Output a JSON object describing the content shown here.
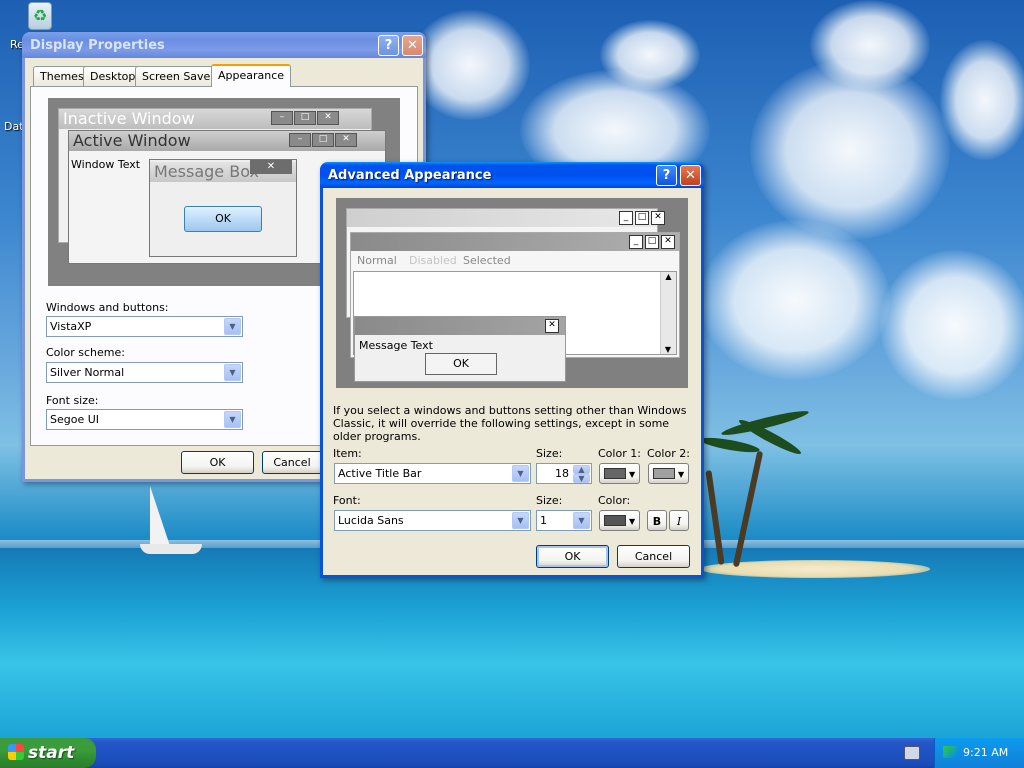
{
  "desktop": {
    "icons": [
      {
        "label": "Re",
        "icon": "recycle-bin-icon"
      },
      {
        "label": "Dat"
      }
    ]
  },
  "display_properties": {
    "title": "Display Properties",
    "tabs": [
      "Themes",
      "Desktop",
      "Screen Saver",
      "Appearance"
    ],
    "active_tab": "Appearance",
    "preview": {
      "inactive_window": "Inactive Window",
      "active_window": "Active Window",
      "window_text": "Window Text",
      "message_box": "Message Box",
      "ok": "OK"
    },
    "windows_and_buttons": {
      "label": "Windows and buttons:",
      "value": "VistaXP"
    },
    "color_scheme": {
      "label": "Color scheme:",
      "value": "Silver Normal"
    },
    "font_size": {
      "label": "Font size:",
      "value": "Segoe UI"
    },
    "ok": "OK",
    "cancel": "Cancel"
  },
  "advanced": {
    "title": "Advanced Appearance",
    "preview": {
      "menu_normal": "Normal",
      "menu_disabled": "Disabled",
      "menu_selected": "Selected",
      "message_text": "Message Text",
      "ok": "OK"
    },
    "note": "If you select a windows and buttons setting other than Windows Classic, it will override the following settings, except in some older programs.",
    "item_label": "Item:",
    "item_value": "Active Title Bar",
    "size_label": "Size:",
    "size_value": "18",
    "color1_label": "Color 1:",
    "color2_label": "Color 2:",
    "font_label": "Font:",
    "font_value": "Lucida Sans",
    "font_size_label": "Size:",
    "font_size_value": "1",
    "color_label": "Color:",
    "bold": "B",
    "italic": "I",
    "ok": "OK",
    "cancel": "Cancel",
    "colors": {
      "color1": "#666666",
      "color2": "#a0a0a0",
      "font_color": "#555555"
    }
  },
  "taskbar": {
    "start": "start",
    "clock": "9:21 AM"
  }
}
